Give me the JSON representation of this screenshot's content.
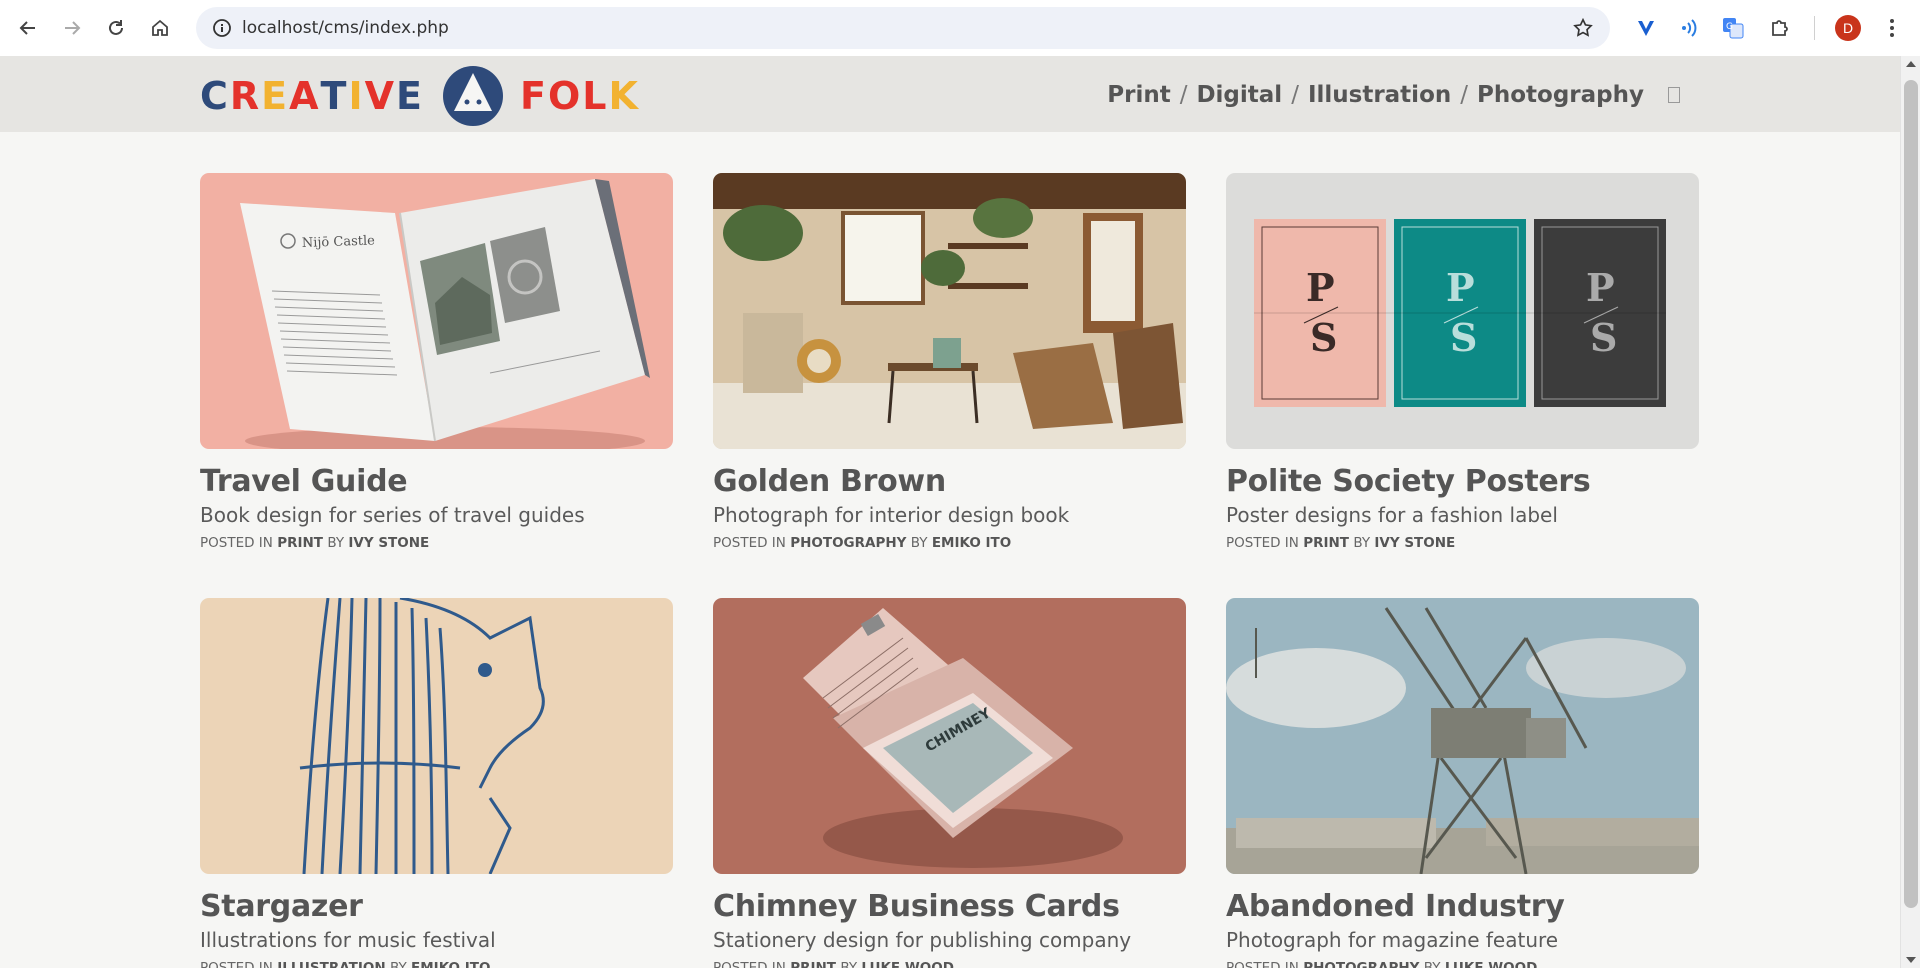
{
  "browser": {
    "url": "localhost/cms/index.php",
    "profile_initial": "D",
    "icons": [
      "back-icon",
      "forward-icon",
      "reload-icon",
      "home-icon",
      "site-info-icon",
      "bookmark-star-icon",
      "extension-v-icon",
      "extension-wave-icon",
      "translate-icon",
      "extensions-puzzle-icon",
      "profile-avatar",
      "kebab-menu-icon"
    ]
  },
  "site": {
    "logo_left": "CREATIVE",
    "logo_right": "FOLK",
    "nav": [
      "Print",
      "Digital",
      "Illustration",
      "Photography"
    ],
    "nav_separator": "/",
    "colors": {
      "header_bg": "#e6e5e2",
      "page_bg": "#f6f6f4",
      "logo_blue": "#2e4a7a",
      "logo_red": "#e4322b",
      "logo_yellow": "#f2b230"
    }
  },
  "cards": [
    {
      "title": "Travel Guide",
      "description": "Book design for series of travel guides",
      "posted_in_label": "POSTED IN",
      "category": "PRINT",
      "by_label": "BY",
      "author": "IVY STONE"
    },
    {
      "title": "Golden Brown",
      "description": "Photograph for interior design book",
      "posted_in_label": "POSTED IN",
      "category": "PHOTOGRAPHY",
      "by_label": "BY",
      "author": "EMIKO ITO"
    },
    {
      "title": "Polite Society Posters",
      "description": "Poster designs for a fashion label",
      "posted_in_label": "POSTED IN",
      "category": "PRINT",
      "by_label": "BY",
      "author": "IVY STONE"
    },
    {
      "title": "Stargazer",
      "description": "Illustrations for music festival",
      "posted_in_label": "POSTED IN",
      "category": "ILLUSTRATION",
      "by_label": "BY",
      "author": "EMIKO ITO"
    },
    {
      "title": "Chimney Business Cards",
      "description": "Stationery design for publishing company",
      "posted_in_label": "POSTED IN",
      "category": "PRINT",
      "by_label": "BY",
      "author": "LUKE WOOD"
    },
    {
      "title": "Abandoned Industry",
      "description": "Photograph for magazine feature",
      "posted_in_label": "POSTED IN",
      "category": "PHOTOGRAPHY",
      "by_label": "BY",
      "author": "LUKE WOOD"
    }
  ],
  "image_text": {
    "book_heading": "Nijō Castle",
    "poster_letters": [
      "P",
      "S"
    ],
    "card_brand": "CHIMNEY"
  }
}
